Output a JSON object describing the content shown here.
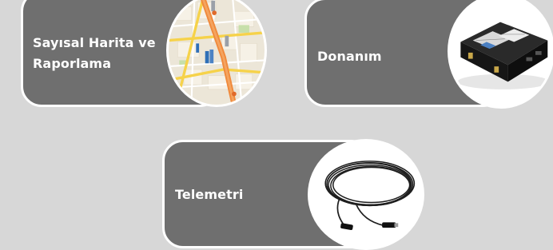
{
  "cards": [
    {
      "label_line1": "Sayısal Harita ve",
      "label_line2": "Raporlama",
      "image": "map-thumbnail"
    },
    {
      "label": "Donanım",
      "image": "gps-tracker-device"
    },
    {
      "label": "Telemetri",
      "image": "coiled-cable"
    }
  ],
  "colors": {
    "background": "#d7d7d7",
    "card": "#6f6f6f",
    "border": "#ffffff",
    "text": "#ffffff"
  }
}
